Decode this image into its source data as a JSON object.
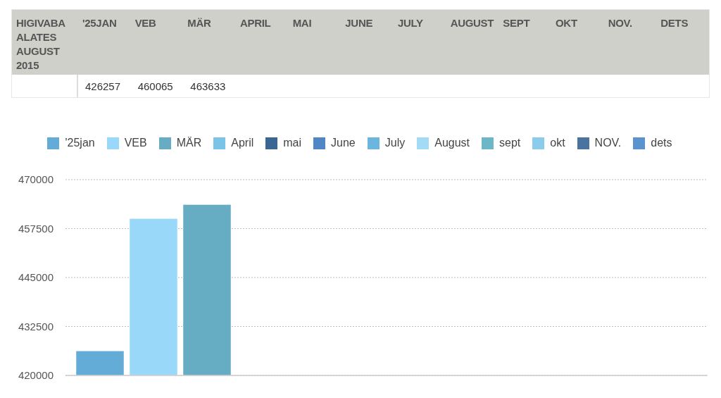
{
  "table": {
    "columns": [
      "HIGIVABA ALATES AUGUST 2015",
      "'25JAN",
      "VEB",
      "MÄR",
      "APRIL",
      "MAI",
      "JUNE",
      "JULY",
      "AUGUST",
      "SEPT",
      "OKT",
      "NOV.",
      "DETS"
    ],
    "rows": [
      [
        "",
        "426257",
        "460065",
        "463633",
        "",
        "",
        "",
        "",
        "",
        "",
        "",
        "",
        ""
      ]
    ]
  },
  "chart": {
    "chart_data": {
      "type": "bar",
      "grid": true,
      "ylim": [
        420000,
        470000
      ],
      "yticks": [
        420000,
        432500,
        445000,
        457500,
        470000
      ],
      "series": [
        {
          "name": "'25jan",
          "color": "#63acd8",
          "values": [
            426257
          ]
        },
        {
          "name": "VEB",
          "color": "#99d8f8",
          "values": [
            460065
          ]
        },
        {
          "name": "MÄR",
          "color": "#66adc3",
          "values": [
            463633
          ]
        },
        {
          "name": "April",
          "color": "#7cc3e8",
          "values": [
            null
          ]
        },
        {
          "name": "mai",
          "color": "#3a6693",
          "values": [
            null
          ]
        },
        {
          "name": "June",
          "color": "#4f86c6",
          "values": [
            null
          ]
        },
        {
          "name": "July",
          "color": "#6ab6de",
          "values": [
            null
          ]
        },
        {
          "name": "August",
          "color": "#a3dbf7",
          "values": [
            null
          ]
        },
        {
          "name": "sept",
          "color": "#6bb7c8",
          "values": [
            null
          ]
        },
        {
          "name": "okt",
          "color": "#8bcbec",
          "values": [
            null
          ]
        },
        {
          "name": "NOV.",
          "color": "#4a73a0",
          "values": [
            null
          ]
        },
        {
          "name": "dets",
          "color": "#5b93cf",
          "values": [
            null
          ]
        }
      ]
    }
  }
}
